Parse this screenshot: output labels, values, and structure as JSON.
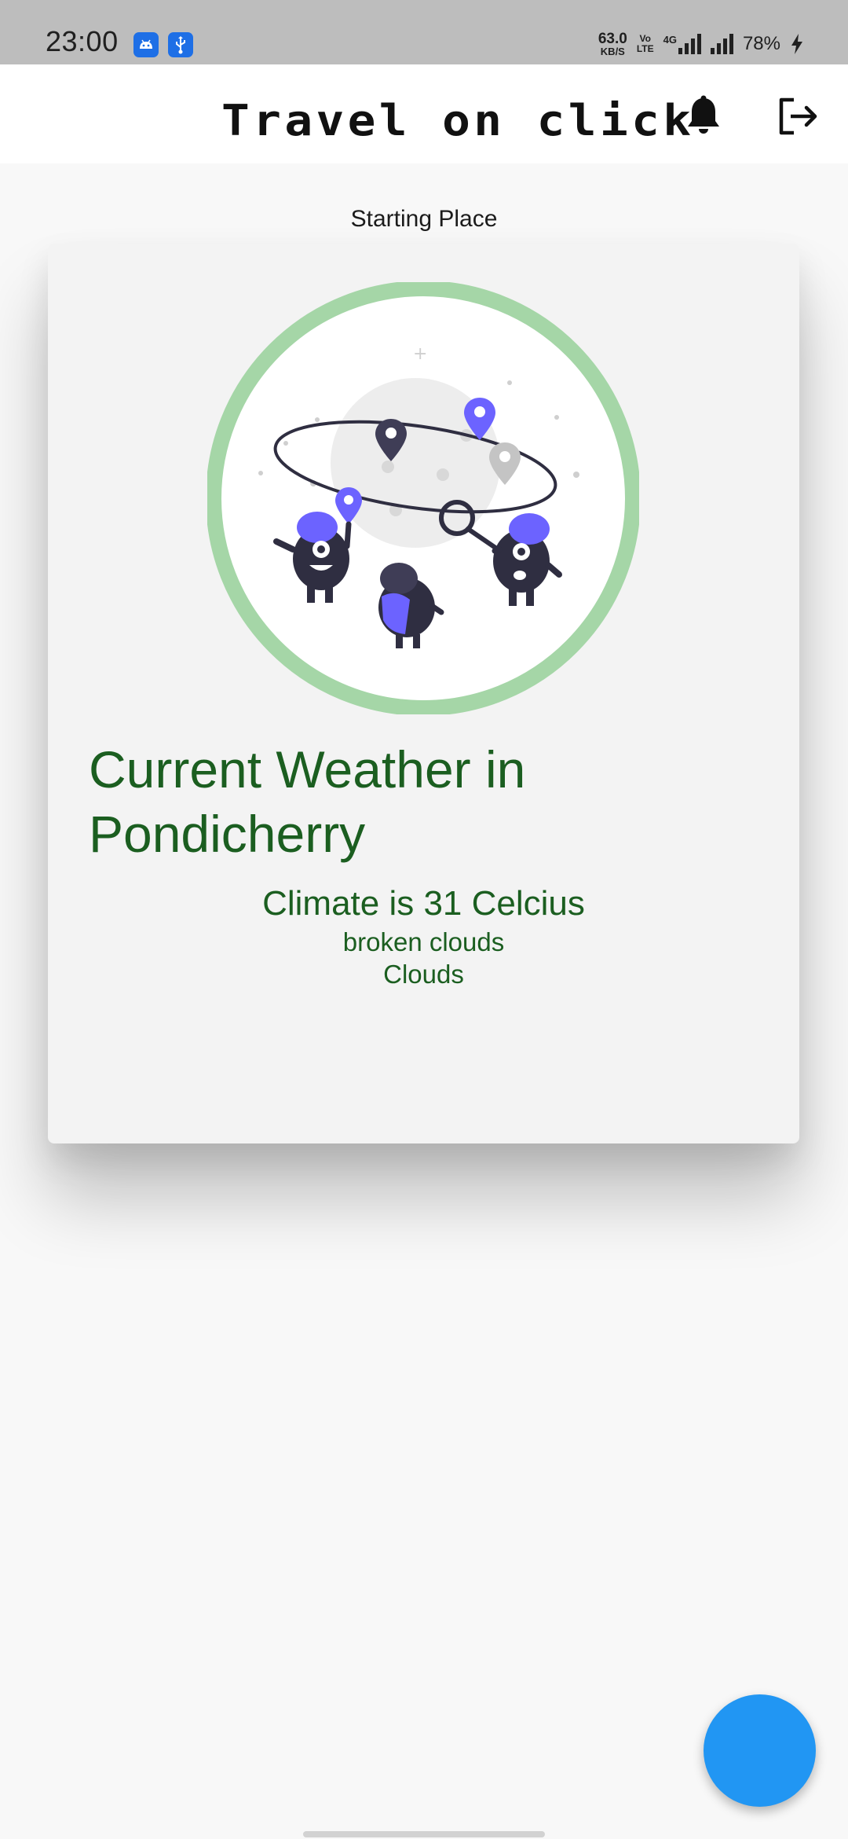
{
  "status_bar": {
    "time": "23:00",
    "net_speed_value": "63.0",
    "net_speed_unit": "KB/S",
    "volte_top": "Vo",
    "volte_bottom": "LTE",
    "network": "4G",
    "battery": "78%"
  },
  "app_bar": {
    "title": "Travel on click",
    "icons": [
      "bell-icon",
      "logout-icon"
    ]
  },
  "section_label": "Starting Place",
  "weather_card": {
    "heading": "Current Weather in Pondicherry",
    "climate": "Climate is 31 Celcius",
    "description": "broken clouds",
    "main": "Clouds"
  },
  "colors": {
    "accent_green": "#1b5e20",
    "ring_green": "#a5d6a7",
    "fab_blue": "#2196f3",
    "illustration_purple": "#6c63ff"
  }
}
